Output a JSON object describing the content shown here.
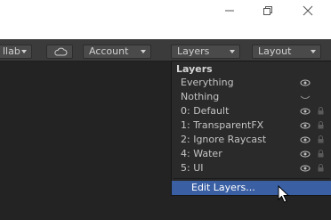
{
  "window": {
    "minimize_icon": "minimize-icon",
    "restore_icon": "restore-icon",
    "close_icon": "close-icon"
  },
  "toolbar": {
    "collab_label": "llab",
    "cloud_icon": "cloud-icon",
    "account_label": "Account",
    "layers_label": "Layers",
    "layout_label": "Layout"
  },
  "layers_menu": {
    "header": "Layers",
    "items": [
      {
        "label": "Everything",
        "icon": "eye-icon"
      },
      {
        "label": "Nothing",
        "icon": "eye-closed-icon"
      },
      {
        "label": "0: Default",
        "icon": "eye-icon",
        "lock": "lock-icon"
      },
      {
        "label": "1: TransparentFX",
        "icon": "eye-icon",
        "lock": "lock-icon"
      },
      {
        "label": "2: Ignore Raycast",
        "icon": "eye-icon",
        "lock": "lock-icon"
      },
      {
        "label": "4: Water",
        "icon": "eye-icon",
        "lock": "lock-icon"
      },
      {
        "label": "5: UI",
        "icon": "eye-icon",
        "lock": "lock-icon"
      }
    ],
    "edit_label": "Edit Layers..."
  },
  "colors": {
    "highlight": "#3a5fa3",
    "toolbar": "#3b3b3b",
    "background": "#232323"
  }
}
